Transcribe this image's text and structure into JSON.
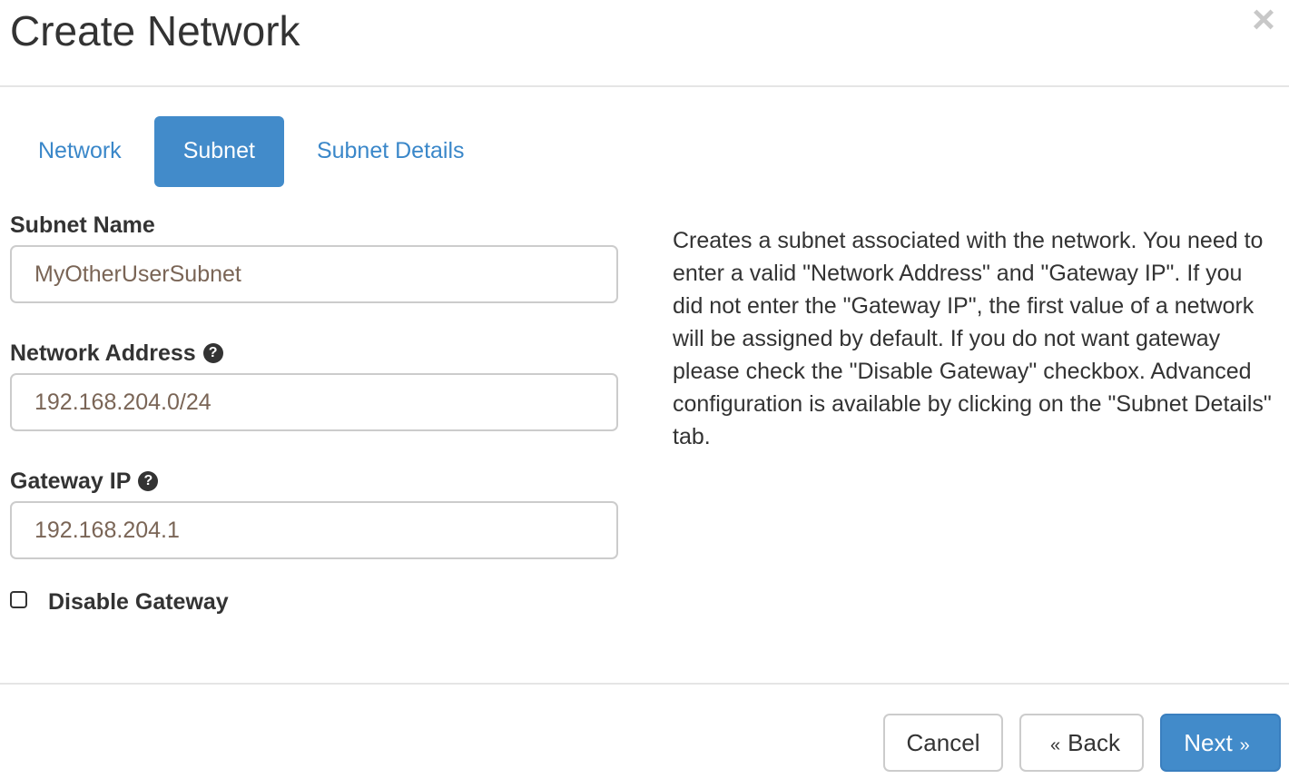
{
  "header": {
    "title": "Create Network",
    "close_glyph": "×"
  },
  "tabs": [
    {
      "label": "Network",
      "active": false
    },
    {
      "label": "Subnet",
      "active": true
    },
    {
      "label": "Subnet Details",
      "active": false
    }
  ],
  "form": {
    "subnet_name": {
      "label": "Subnet Name",
      "value": "MyOtherUserSubnet"
    },
    "network_address": {
      "label": "Network Address",
      "value": "192.168.204.0/24",
      "help_glyph": "?"
    },
    "gateway_ip": {
      "label": "Gateway IP",
      "value": "192.168.204.1",
      "help_glyph": "?"
    },
    "disable_gateway": {
      "label": "Disable Gateway",
      "checked": false
    }
  },
  "description": "Creates a subnet associated with the network. You need to enter a valid \"Network Address\" and \"Gateway IP\". If you did not enter the \"Gateway IP\", the first value of a network will be assigned by default. If you do not want gateway please check the \"Disable Gateway\" checkbox. Advanced configuration is available by clicking on the \"Subnet Details\" tab.",
  "footer": {
    "cancel_label": "Cancel",
    "back_label": "Back",
    "back_glyph": "«",
    "next_label": "Next",
    "next_glyph": "»"
  },
  "colors": {
    "primary": "#428bca",
    "link": "#3a87c9",
    "input_text": "#7a6556"
  },
  "icons": {
    "close": "close-icon",
    "help": "question-circle-icon",
    "back": "double-chevron-left-icon",
    "next": "double-chevron-right-icon"
  }
}
